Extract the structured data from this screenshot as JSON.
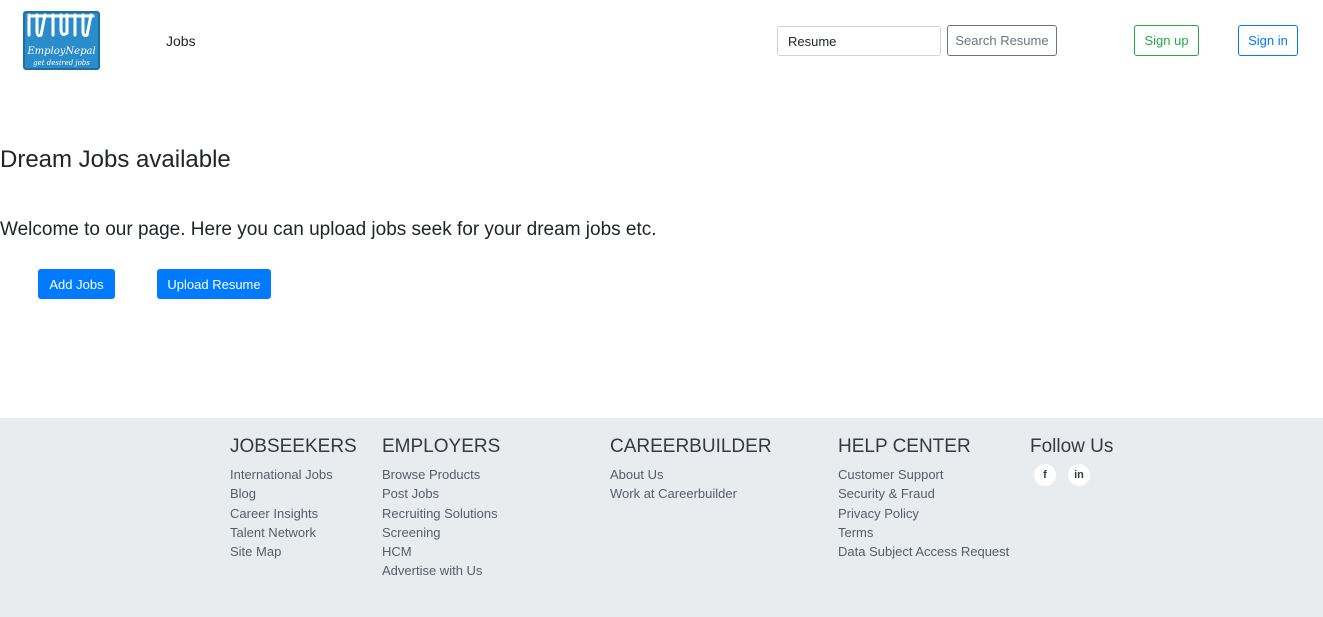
{
  "header": {
    "logo_text": "EmployNepal",
    "logo_tagline": "get desired jobs",
    "nav_jobs": "Jobs",
    "search_value": "Resume",
    "search_button": "Search Resume",
    "signup": "Sign up",
    "signin": "Sign in"
  },
  "hero": {
    "title": "Dream Jobs available",
    "text": "Welcome to our page. Here you can upload jobs seek for your dream jobs etc.",
    "add_jobs": "Add Jobs",
    "upload_resume": "Upload Resume"
  },
  "footer": {
    "columns": [
      {
        "heading": "JOBSEEKERS",
        "links": [
          "International Jobs",
          "Blog",
          "Career Insights",
          "Talent Network",
          "Site Map"
        ]
      },
      {
        "heading": "EMPLOYERS",
        "links": [
          "Browse Products",
          "Post Jobs",
          "Recruiting Solutions",
          "Screening",
          "HCM",
          "Advertise with Us"
        ]
      },
      {
        "heading": "CAREERBUILDER",
        "links": [
          "About Us",
          "Work at Careerbuilder"
        ]
      },
      {
        "heading": "HELP CENTER",
        "links": [
          "Customer Support",
          "Security & Fraud",
          "Privacy Policy",
          "Terms",
          "Data Subject Access Request"
        ]
      }
    ],
    "follow": {
      "heading": "Follow Us",
      "facebook": "f",
      "linkedin": "in"
    }
  },
  "colors": {
    "primary": "#007bff",
    "success": "#28a745",
    "secondary": "#6c757d",
    "footer_bg": "#e9ecef",
    "logo_bg": "#2b8ccc"
  },
  "icons": {
    "facebook": "facebook-icon",
    "linkedin": "linkedin-icon",
    "logo": "employnepal-logo"
  }
}
